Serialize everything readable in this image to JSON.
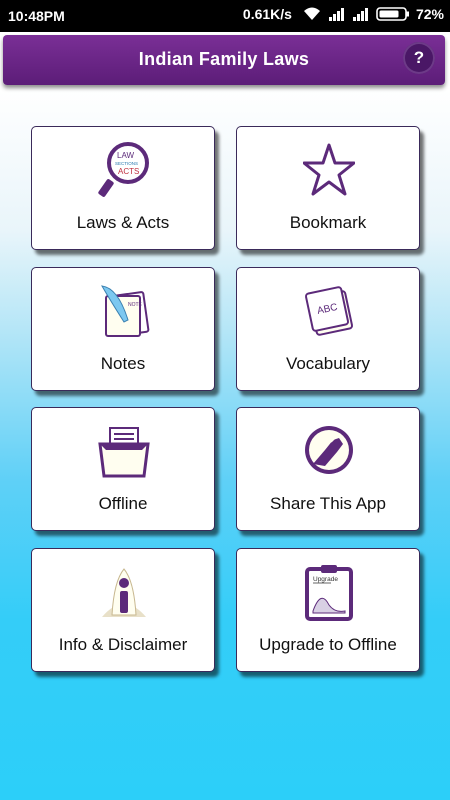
{
  "status_bar": {
    "time": "10:48PM",
    "network_speed": "0.61K/s",
    "battery_percent": "72%",
    "icons": [
      "wifi-icon",
      "signal-icon",
      "signal-icon",
      "battery-icon"
    ]
  },
  "header": {
    "title": "Indian Family Laws",
    "help_label": "?"
  },
  "tiles": [
    {
      "label": "Laws & Acts",
      "icon": "magnifier-icon"
    },
    {
      "label": "Bookmark",
      "icon": "star-icon"
    },
    {
      "label": "Notes",
      "icon": "quill-icon"
    },
    {
      "label": "Vocabulary",
      "icon": "abc-notepad-icon"
    },
    {
      "label": "Offline",
      "icon": "file-box-icon"
    },
    {
      "label": "Share This App",
      "icon": "handshake-icon"
    },
    {
      "label": "Info & Disclaimer",
      "icon": "info-icon"
    },
    {
      "label": "Upgrade to Offline",
      "icon": "upgrade-clipboard-icon"
    }
  ],
  "icon_text": {
    "law": "LAW",
    "sections": "SECTIONS",
    "acts": "ACTS",
    "notes_mark": "NOTE",
    "abc": "ABC",
    "upgrade": "Upgrade"
  },
  "colors": {
    "app_bar": "#6a2687",
    "icon_purple": "#5c2a7a",
    "background_top": "#ffffff",
    "background_bottom": "#2ccff9"
  }
}
